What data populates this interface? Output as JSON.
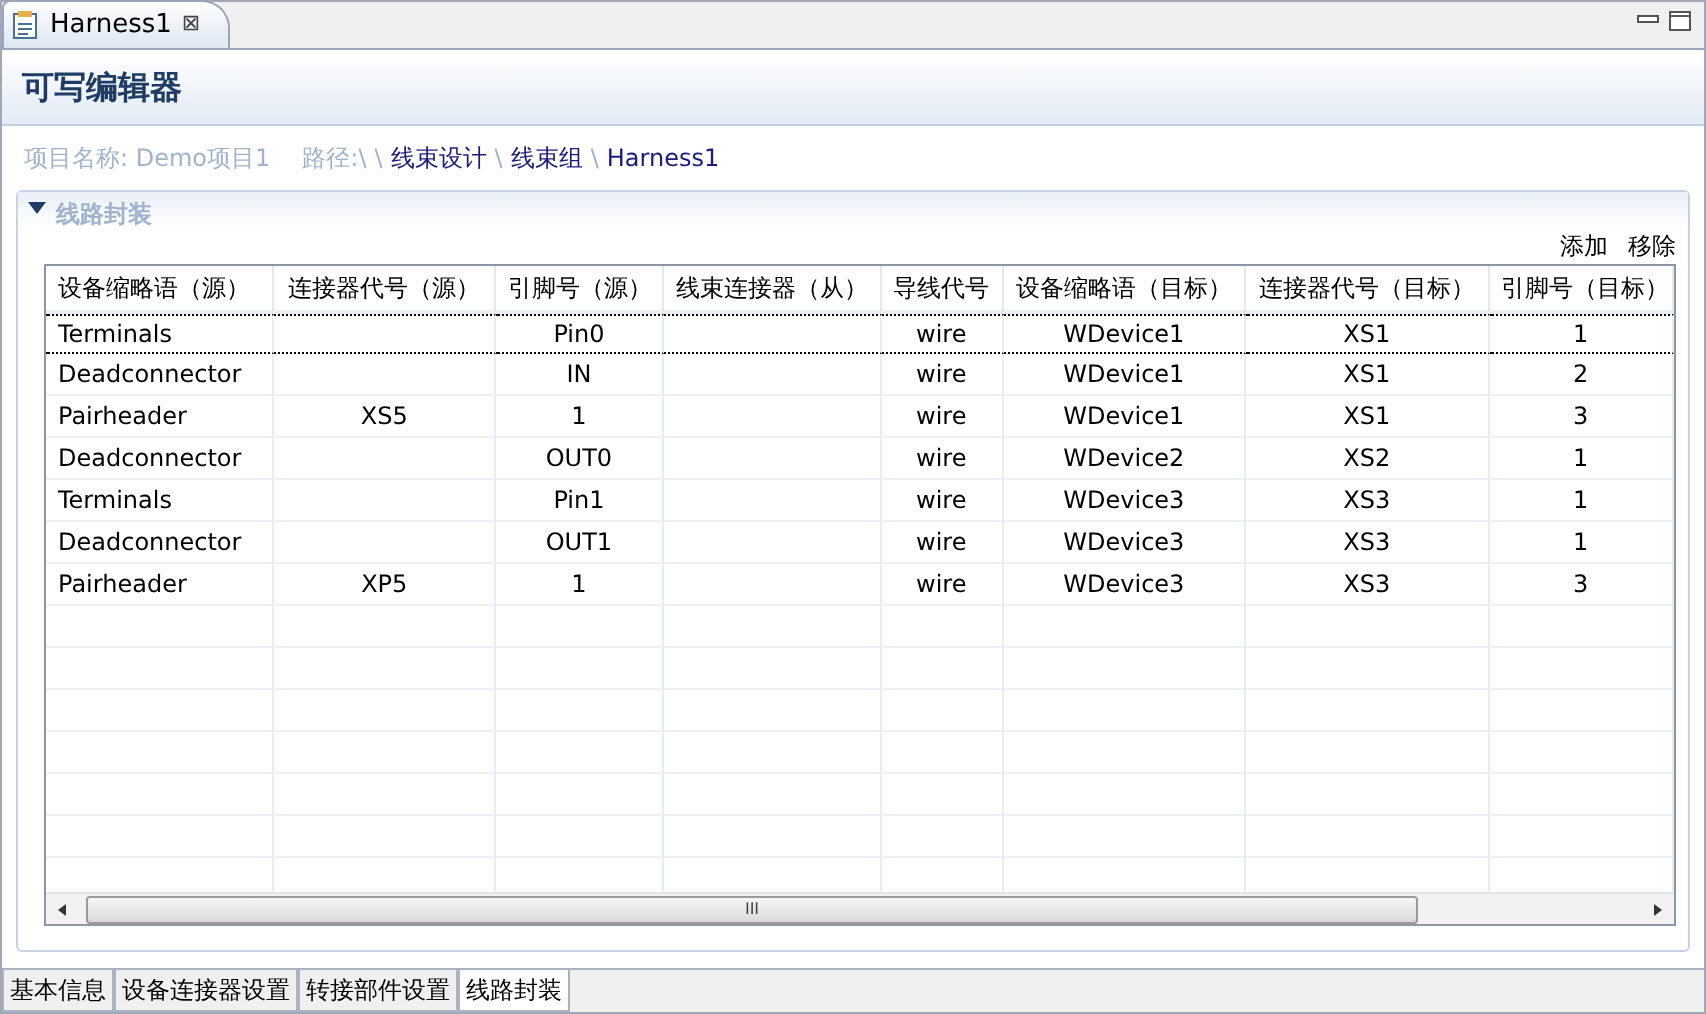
{
  "editor_tab": {
    "title": "Harness1",
    "close": "⊠",
    "selected": true
  },
  "header": {
    "title": "可写编辑器"
  },
  "info": {
    "project_label": "项目名称: Demo项目1",
    "path_label": "路径:\\",
    "path": [
      {
        "separator": "\\",
        "label": "线束设计"
      },
      {
        "separator": "\\",
        "label": "线束组"
      },
      {
        "separator": "\\",
        "label": "Harness1"
      }
    ]
  },
  "section": {
    "title": "线路封装",
    "expanded": true,
    "actions": [
      "添加",
      "移除"
    ]
  },
  "table": {
    "columns": [
      "设备缩略语（源）",
      "连接器代号（源）",
      "引脚号（源）",
      "线束连接器（从）",
      "导线代号",
      "设备缩略语（目标）",
      "连接器代号（目标）",
      "引脚号（目标）"
    ],
    "rows": [
      {
        "cells": [
          "Terminals",
          "",
          "Pin0",
          "",
          "wire",
          "WDevice1",
          "XS1",
          "1"
        ],
        "selected": true
      },
      {
        "cells": [
          "Deadconnector",
          "",
          "IN",
          "",
          "wire",
          "WDevice1",
          "XS1",
          "2"
        ],
        "selected": false
      },
      {
        "cells": [
          "Pairheader",
          "XS5",
          "1",
          "",
          "wire",
          "WDevice1",
          "XS1",
          "3"
        ],
        "selected": false
      },
      {
        "cells": [
          "Deadconnector",
          "",
          "OUT0",
          "",
          "wire",
          "WDevice2",
          "XS2",
          "1"
        ],
        "selected": false
      },
      {
        "cells": [
          "Terminals",
          "",
          "Pin1",
          "",
          "wire",
          "WDevice3",
          "XS3",
          "1"
        ],
        "selected": false
      },
      {
        "cells": [
          "Deadconnector",
          "",
          "OUT1",
          "",
          "wire",
          "WDevice3",
          "XS3",
          "1"
        ],
        "selected": false
      },
      {
        "cells": [
          "Pairheader",
          "XP5",
          "1",
          "",
          "wire",
          "WDevice3",
          "XS3",
          "3"
        ],
        "selected": false
      }
    ],
    "scroll_grip": "III"
  },
  "page_tabs": [
    {
      "label": "基本信息",
      "selected": false
    },
    {
      "label": "设备连接器设置",
      "selected": false
    },
    {
      "label": "转接部件设置",
      "selected": false
    },
    {
      "label": "线路封装",
      "selected": true
    }
  ]
}
